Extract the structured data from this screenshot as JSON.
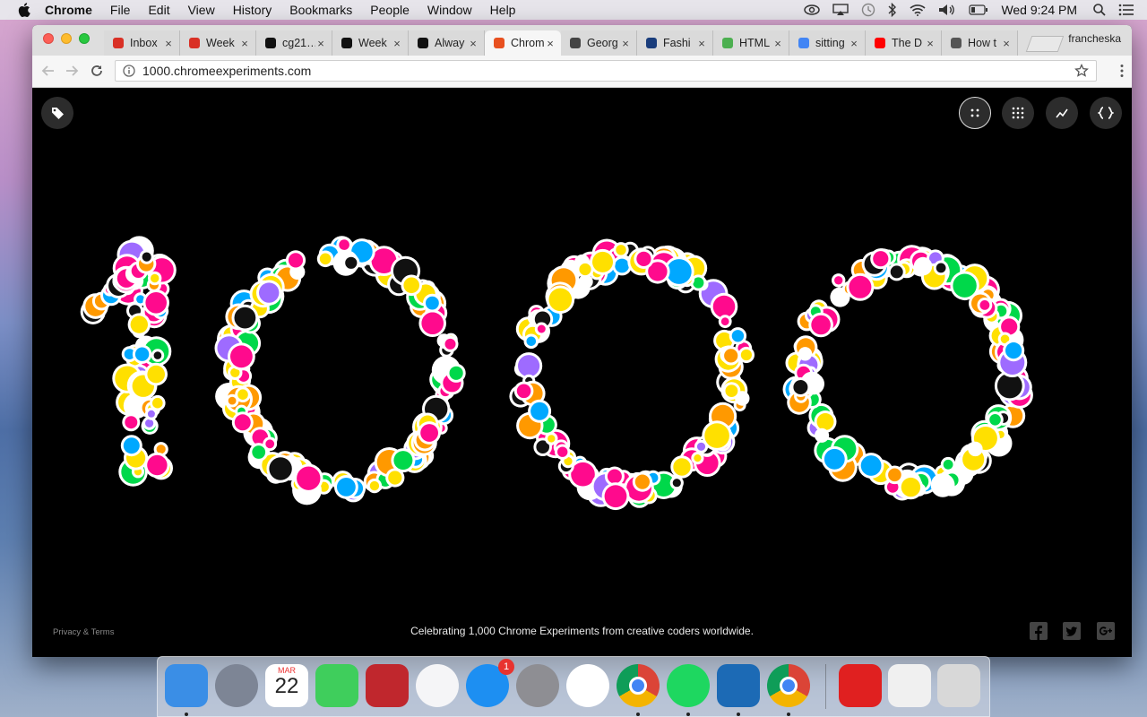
{
  "menubar": {
    "app_name": "Chrome",
    "items": [
      "File",
      "Edit",
      "View",
      "History",
      "Bookmarks",
      "People",
      "Window",
      "Help"
    ],
    "clock": "Wed 9:24 PM"
  },
  "tabs": [
    {
      "title": "Inbox",
      "icon": "gmail-icon",
      "color": "#d93025"
    },
    {
      "title": "Week",
      "icon": "gmail-icon",
      "color": "#d93025"
    },
    {
      "title": "cg21…",
      "icon": "github-icon",
      "color": "#111111"
    },
    {
      "title": "Week",
      "icon": "github-icon",
      "color": "#111111"
    },
    {
      "title": "Alway",
      "icon": "always-icon",
      "color": "#111111"
    },
    {
      "title": "Chrom",
      "icon": "chrome-experiments-icon",
      "color": "#e8501f",
      "active": true
    },
    {
      "title": "Georg",
      "icon": "hand-icon",
      "color": "#444444"
    },
    {
      "title": "Fashi",
      "icon": "fit-icon",
      "color": "#1a3d7c"
    },
    {
      "title": "HTML",
      "icon": "w3-icon",
      "color": "#4caf50"
    },
    {
      "title": "sitting",
      "icon": "google-icon",
      "color": "#4285f4"
    },
    {
      "title": "The D",
      "icon": "youtube-icon",
      "color": "#ff0000"
    },
    {
      "title": "How t",
      "icon": "apple-icon",
      "color": "#555555"
    }
  ],
  "profile_name": "francheska",
  "address_bar": {
    "url": "1000.chromeexperiments.com"
  },
  "page": {
    "tagline": "Celebrating 1,000 Chrome Experiments from creative coders worldwide.",
    "privacy": "Privacy & Terms",
    "artwork_text": "1000"
  },
  "dock": {
    "apps": [
      {
        "name": "finder-icon",
        "color": "#3a8ee6"
      },
      {
        "name": "launchpad-icon",
        "color": "#7d8595"
      },
      {
        "name": "calendar-icon",
        "color": "#ffffff",
        "month": "MAR",
        "day": "22"
      },
      {
        "name": "facetime-icon",
        "color": "#3fce5c"
      },
      {
        "name": "photo-booth-icon",
        "color": "#c0272d"
      },
      {
        "name": "itunes-icon",
        "color": "#f5f5f7"
      },
      {
        "name": "app-store-icon",
        "color": "#1d8ff2",
        "badge": "1"
      },
      {
        "name": "system-preferences-icon",
        "color": "#8e8e93"
      },
      {
        "name": "photos-icon",
        "color": "#ffffff"
      },
      {
        "name": "chrome-icon",
        "color": "#db4437"
      },
      {
        "name": "spotify-icon",
        "color": "#1ed760"
      },
      {
        "name": "brackets-icon",
        "color": "#1c6ab5"
      },
      {
        "name": "chrome-icon",
        "color": "#db4437"
      },
      {
        "name": "chrome-window-thumb-icon",
        "color": "#e02020"
      },
      {
        "name": "window-thumb-icon",
        "color": "#f0f0f0"
      },
      {
        "name": "trash-icon",
        "color": "#d8d8d8"
      }
    ]
  }
}
